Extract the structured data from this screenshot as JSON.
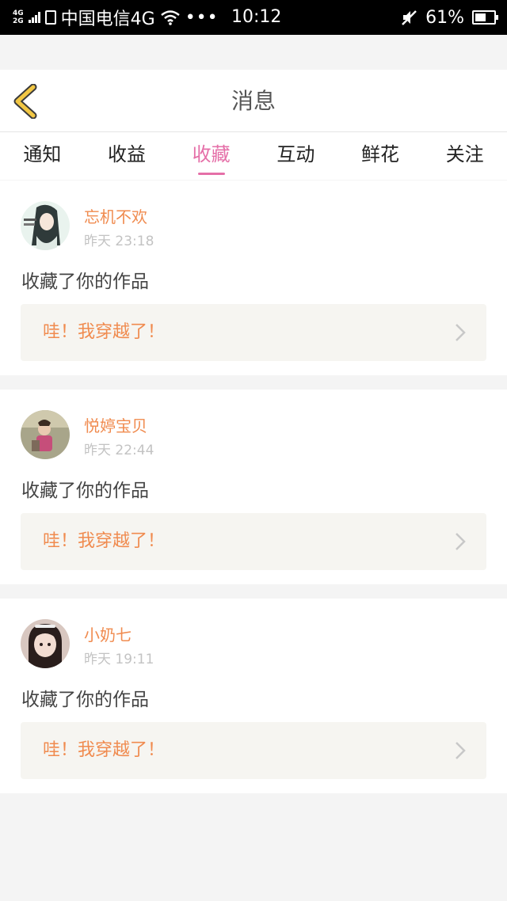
{
  "status_bar": {
    "network_top": "4G",
    "network_bottom": "2G",
    "carrier": "中国电信4G",
    "overflow": "•••",
    "time": "10:12",
    "battery_percent": "61%",
    "battery_level": 0.61,
    "icons": [
      "signal-icon",
      "sim-icon",
      "wifi-icon",
      "mute-icon",
      "battery-icon"
    ]
  },
  "header": {
    "title": "消息",
    "back_icon": "chevron-left-icon",
    "accent_color": "#f2c744"
  },
  "tabs": [
    {
      "label": "通知",
      "active": false
    },
    {
      "label": "收益",
      "active": false
    },
    {
      "label": "收藏",
      "active": true
    },
    {
      "label": "互动",
      "active": false
    },
    {
      "label": "鲜花",
      "active": false
    },
    {
      "label": "关注",
      "active": false
    }
  ],
  "colors": {
    "active_tab": "#e56fa8",
    "username": "#f08b4f",
    "work_title": "#f08b4f",
    "work_box_bg": "#f6f5f1"
  },
  "messages": [
    {
      "user": "忘机不欢",
      "time": "昨天 23:18",
      "action": "收藏了你的作品",
      "work_title": "哇！我穿越了！",
      "avatar_icon": "avatar-anime-icon"
    },
    {
      "user": "悦婷宝贝",
      "time": "昨天 22:44",
      "action": "收藏了你的作品",
      "work_title": "哇！我穿越了！",
      "avatar_icon": "avatar-child-icon"
    },
    {
      "user": "小奶七",
      "time": "昨天 19:11",
      "action": "收藏了你的作品",
      "work_title": "哇！我穿越了！",
      "avatar_icon": "avatar-girl-icon"
    }
  ]
}
